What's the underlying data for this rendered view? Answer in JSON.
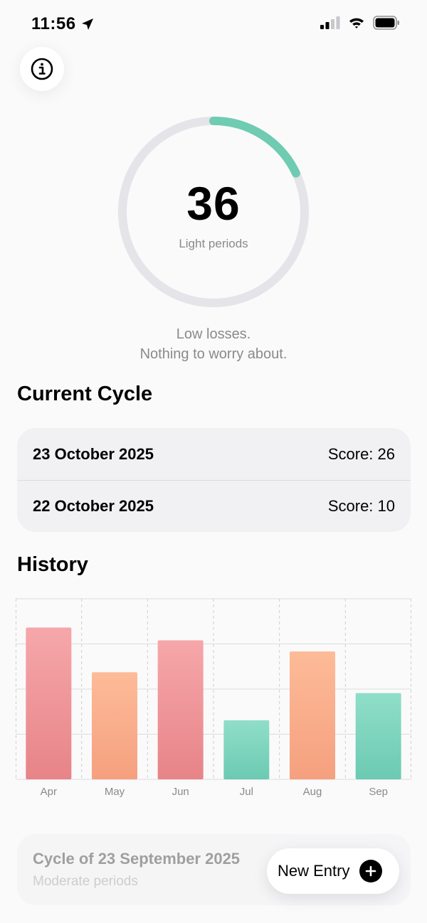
{
  "status_bar": {
    "time": "11:56"
  },
  "score": {
    "value": "36",
    "label": "Light periods",
    "progress": 0.18,
    "track_color": "#e4e4e9",
    "progress_color": "#6fcbb1"
  },
  "summary": {
    "line1": "Low losses.",
    "line2": "Nothing to worry about."
  },
  "current_cycle": {
    "title": "Current Cycle",
    "entries": [
      {
        "date": "23 October 2025",
        "score": "Score: 26"
      },
      {
        "date": "22 October 2025",
        "score": "Score: 10"
      }
    ]
  },
  "history": {
    "title": "History"
  },
  "chart_data": {
    "type": "bar",
    "categories": [
      "Apr",
      "May",
      "Jun",
      "Jul",
      "Aug",
      "Sep"
    ],
    "values": [
      95,
      67,
      87,
      37,
      80,
      54
    ],
    "ylim": [
      0,
      113
    ],
    "grid": true,
    "legend": "none",
    "colors": {
      "red": "#ee8a8e",
      "orange": "#f8a98a",
      "green": "#7dd3be"
    },
    "bar_colors": [
      "red",
      "orange",
      "red",
      "green",
      "orange",
      "green"
    ]
  },
  "previous_cycle": {
    "title": "Cycle of 23 September 2025",
    "subtitle": "Moderate periods"
  },
  "new_entry": {
    "label": "New Entry"
  },
  "icons": {
    "location": "location-arrow-icon",
    "signal": "cellular-signal-icon",
    "wifi": "wifi-icon",
    "battery": "battery-icon",
    "info": "info-icon",
    "plus": "plus-icon"
  }
}
